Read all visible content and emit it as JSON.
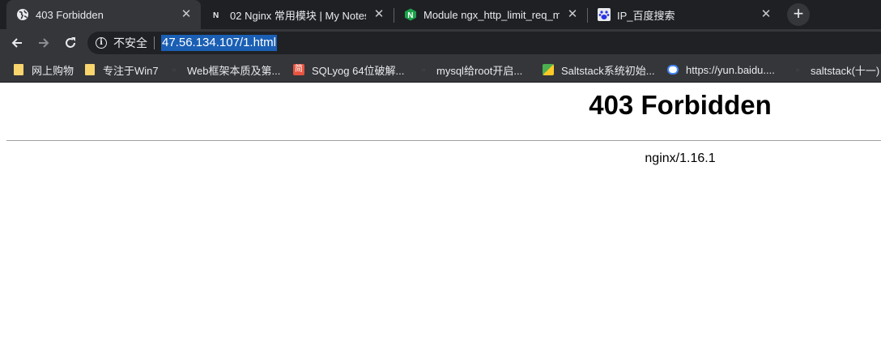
{
  "tabs": [
    {
      "title": "403 Forbidden",
      "icon": "globe-icon",
      "active": true
    },
    {
      "title": "02 Nginx 常用模块 | My Notes",
      "icon": "notion-icon",
      "active": false
    },
    {
      "title": "Module ngx_http_limit_req_m",
      "icon": "nginx-icon",
      "active": false
    },
    {
      "title": "IP_百度搜索",
      "icon": "baidu-paw-icon",
      "active": false
    }
  ],
  "toolbar": {
    "security_label": "不安全",
    "url": "47.56.134.107/1.html"
  },
  "bookmarks": [
    {
      "label": "网上购物",
      "icon": "folder-icon"
    },
    {
      "label": "专注于Win7",
      "icon": "folder-icon"
    },
    {
      "label": "Web框架本质及第...",
      "icon": "page-icon"
    },
    {
      "label": "SQLyog 64位破解...",
      "icon": "jian-icon"
    },
    {
      "label": "mysql给root开启...",
      "icon": "page-icon"
    },
    {
      "label": "Saltstack系统初始...",
      "icon": "saltstack-icon"
    },
    {
      "label": "https://yun.baidu....",
      "icon": "baidu-cloud-icon"
    },
    {
      "label": "saltstack(十一)",
      "icon": "page-icon"
    }
  ],
  "page": {
    "heading": "403 Forbidden",
    "server": "nginx/1.16.1"
  },
  "colors": {
    "tabstrip": "#1f2023",
    "toolbar": "#35363a",
    "url_highlight": "#1a5fb4"
  }
}
